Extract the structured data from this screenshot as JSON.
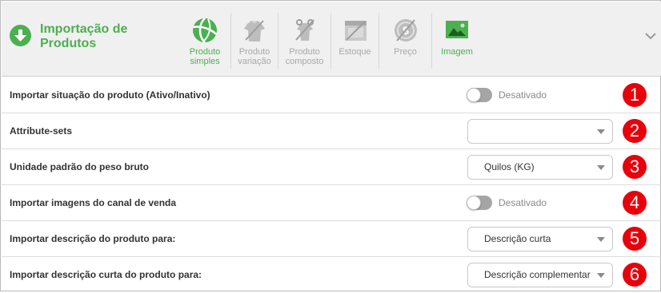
{
  "header": {
    "title": "Importação de Produtos",
    "title_icon": "download-arrow-icon",
    "accent_color": "#4caf50",
    "inactive_color": "#a8a8a8",
    "tabs": [
      {
        "label": "Produto simples",
        "icon": "beach-ball-icon",
        "active": true
      },
      {
        "label": "Produto variação",
        "icon": "shirt-variation-icon",
        "active": false
      },
      {
        "label": "Produto composto",
        "icon": "composite-shirt-icon",
        "active": false
      },
      {
        "label": "Estoque",
        "icon": "stock-box-icon",
        "active": false
      },
      {
        "label": "Preço",
        "icon": "price-coin-icon",
        "active": false
      },
      {
        "label": "Imagem",
        "icon": "image-icon",
        "active": true
      }
    ],
    "collapse_icon": "chevron-down-icon"
  },
  "rows": [
    {
      "label": "Importar situação do produto (Ativo/Inativo)",
      "control": "toggle",
      "value": "Desativado",
      "badge": "1"
    },
    {
      "label": "Attribute-sets",
      "control": "select",
      "value": "",
      "badge": "2"
    },
    {
      "label": "Unidade padrão do peso bruto",
      "control": "select",
      "value": "Quilos (KG)",
      "badge": "3"
    },
    {
      "label": "Importar imagens do canal de venda",
      "control": "toggle",
      "value": "Desativado",
      "badge": "4"
    },
    {
      "label": "Importar descrição do produto para:",
      "control": "select",
      "value": "Descrição curta",
      "badge": "5"
    },
    {
      "label": "Importar descrição curta do produto para:",
      "control": "select",
      "value": "Descrição complementar",
      "badge": "6"
    }
  ],
  "badge_color": "#e8000b"
}
